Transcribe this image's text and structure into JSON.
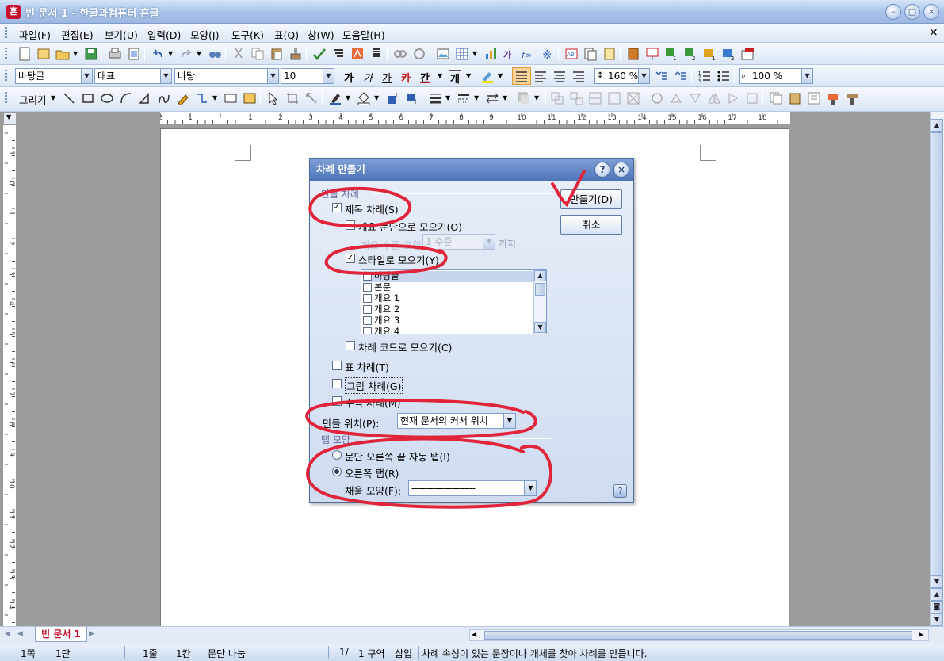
{
  "window": {
    "title": "빈 문서 1 - 한글과컴퓨터 흔글",
    "app_icon": "흔"
  },
  "menu": [
    "파일(F)",
    "편집(E)",
    "보기(U)",
    "입력(D)",
    "모양(J)",
    "도구(K)",
    "표(Q)",
    "창(W)",
    "도움말(H)"
  ],
  "format_toolbar": {
    "style": "바탕글",
    "font_lang": "대표",
    "font_name": "바탕",
    "font_size": "10",
    "char_bold": "가",
    "char_italic": "가",
    "char_underline": "가",
    "char_strike": "카",
    "char_color": "간",
    "char_shade": "개",
    "line_spacing": "160 %",
    "zoom": "100 %"
  },
  "draw_toolbar": {
    "draw_label": "그리기"
  },
  "ruler": {
    "h_ticks": [
      "2",
      "1",
      "",
      "1",
      "2",
      "3",
      "4",
      "5",
      "6",
      "7",
      "8",
      "9",
      "10",
      "11",
      "12",
      "13",
      "14",
      "15",
      "16",
      "17",
      "18"
    ],
    "v_ticks": [
      "1",
      "0",
      "1",
      "2",
      "3",
      "4",
      "5",
      "6",
      "7",
      "8",
      "9",
      "10",
      "11",
      "12",
      "13",
      "14",
      "15"
    ]
  },
  "dialog": {
    "title": "차례 만들기",
    "group_make": "만들 차례",
    "cb_title": "제목 차례(S)",
    "cb_title_checked": true,
    "cb_outline": "개요 문단으로 모으기(O)",
    "outline_level_text": "개요 수준 포함",
    "outline_level_value": "1 수준",
    "outline_until": "까지",
    "cb_style": "스타일로 모으기(Y)",
    "cb_style_checked": true,
    "style_list": [
      "바탕글",
      "본문",
      "개요 1",
      "개요 2",
      "개요 3",
      "개요 4"
    ],
    "cb_code": "차례 코드로 모으기(C)",
    "cb_table": "표 차례(T)",
    "cb_picture": "그림 차례(G)",
    "cb_equation": "수식 차례(M)",
    "position_label": "만들 위치(P):",
    "position_value": "현재 문서의 커서 위치",
    "group_tab": "탭 모양",
    "radio_auto_tab": "문단 오른쪽 끝 자동 탭(I)",
    "radio_right_tab": "오른쪽 탭(R)",
    "fill_label": "채울 모양(F):",
    "fill_value": "------------------------",
    "btn_make": "만들기(D)",
    "btn_cancel": "취소",
    "help_icon": "?",
    "close_icon": "×"
  },
  "tabs": {
    "doc_tab": "빈 문서 1"
  },
  "status": {
    "page": "1쪽",
    "column": "1단",
    "line": "1줄",
    "col": "1칸",
    "break": "문단 나눔",
    "page_of": "1/",
    "section": "1 구역",
    "mode": "삽입",
    "message": "차례 속성이 있는 문장이나 개체를 찾아 차례를 만듭니다."
  },
  "colors": {
    "annotation_red": "#e0253b",
    "title_blue": "#4e75ba",
    "tab_red": "#c8102e"
  }
}
